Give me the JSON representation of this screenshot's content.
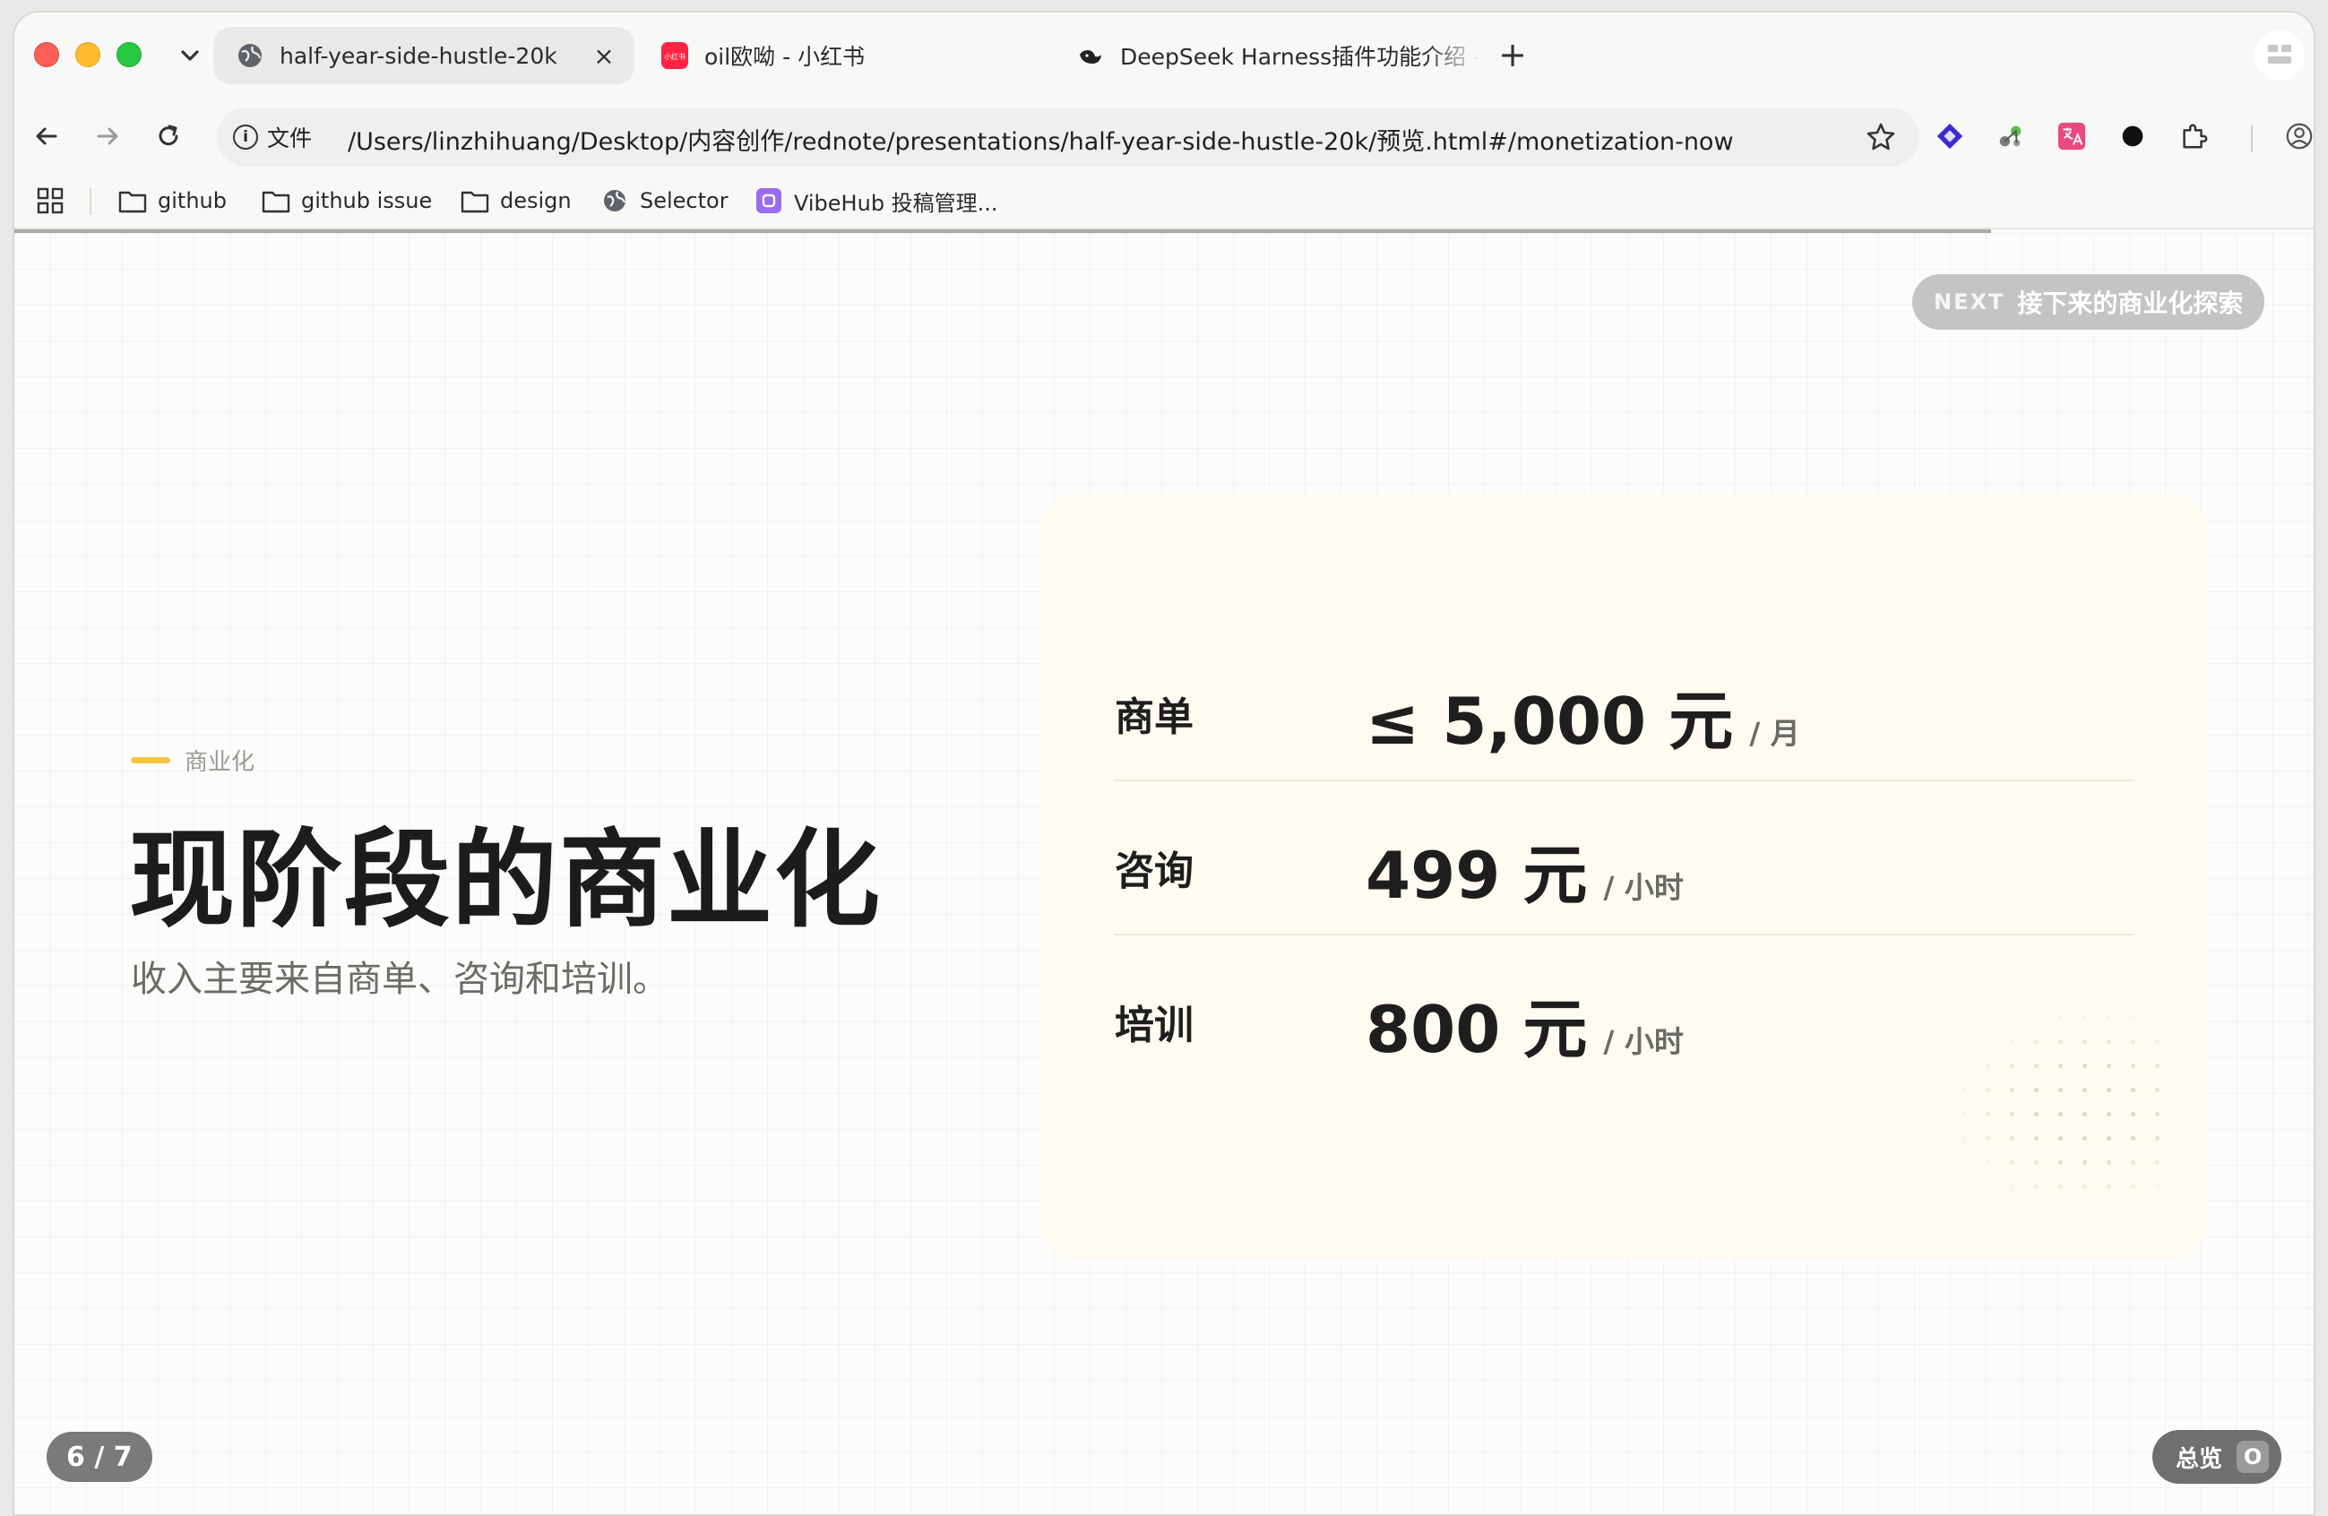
{
  "browser": {
    "tabs": [
      {
        "title": "half-year-side-hustle-20k"
      },
      {
        "title": "oil欧呦 - 小红书",
        "favicon_text": "小红书"
      },
      {
        "title": "DeepSeek Harness插件功能介绍 –"
      }
    ],
    "new_tab": "+",
    "close": "×",
    "info_label": "文件",
    "url": "/Users/linzhihuang/Desktop/内容创作/rednote/presentations/half-year-side-hustle-20k/预览.html#/monetization-now",
    "bookmarks": [
      {
        "label": "github"
      },
      {
        "label": "github issue"
      },
      {
        "label": "design"
      },
      {
        "label": "Selector"
      },
      {
        "label": "VibeHub 投稿管理..."
      }
    ]
  },
  "slide": {
    "next_key": "NEXT",
    "next_label": "接下来的商业化探索",
    "eyebrow": "商业化",
    "title": "现阶段的商业化",
    "subtitle": "收入主要来自商单、咨询和培训。",
    "rows": [
      {
        "label": "商单",
        "value": "≤ 5,000 元",
        "unit": "/ 月"
      },
      {
        "label": "咨询",
        "value": "499 元",
        "unit": "/ 小时"
      },
      {
        "label": "培训",
        "value": "800 元",
        "unit": "/ 小时"
      }
    ],
    "counter": "6 / 7",
    "overview_label": "总览",
    "overview_key": "O"
  },
  "colors": {
    "accent": "#f5c542",
    "card": "#fffbf0",
    "pill": "#c4c4c2"
  }
}
